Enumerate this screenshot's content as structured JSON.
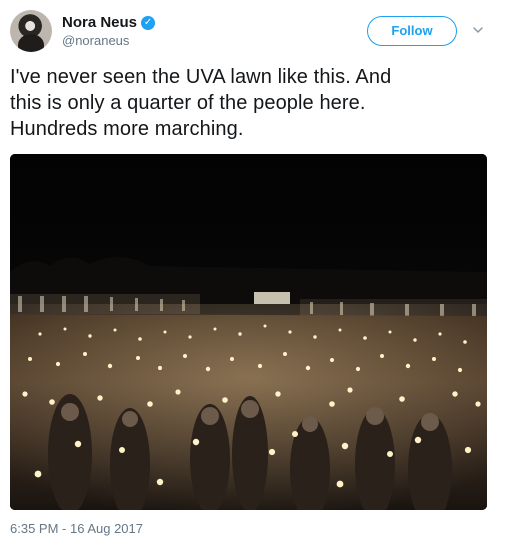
{
  "author": {
    "display_name": "Nora Neus",
    "handle": "@noraneus",
    "verified": true,
    "avatar_icon": "avatar-photo"
  },
  "actions": {
    "follow_label": "Follow",
    "menu_icon": "chevron-down-icon"
  },
  "tweet": {
    "text_lines": [
      "I've never seen the UVA lawn like this. And",
      "this is only a quarter of the people here.",
      "Hundreds more marching."
    ],
    "timestamp": "6:35 PM - 16 Aug 2017"
  },
  "colors": {
    "accent": "#1da1f2",
    "text": "#14171a",
    "secondary": "#657786"
  }
}
